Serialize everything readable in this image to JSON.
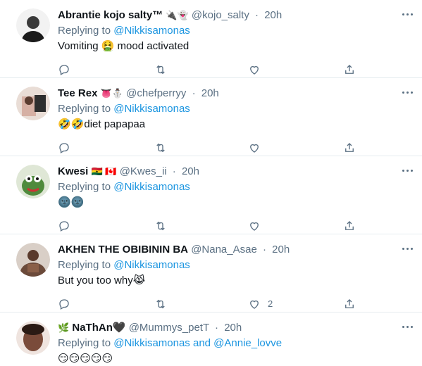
{
  "tweets": [
    {
      "name": "Abrantie kojo salty™",
      "emoji": "🔌👻",
      "handle": "@kojo_salty",
      "time": "20h",
      "replying_prefix": "Replying to",
      "mentions": "@Nikkisamonas",
      "text": "Vomiting 🤮 mood activated",
      "like_count": "",
      "avatar_color": "#2b2b2b"
    },
    {
      "name": "Tee Rex",
      "emoji": "👅⛄",
      "handle": "@chefperryy",
      "time": "20h",
      "replying_prefix": "Replying to",
      "mentions": "@Nikkisamonas",
      "text": "🤣🤣diet papapaa",
      "like_count": "",
      "avatar_color": "#c9a89c"
    },
    {
      "name": "Kwesi",
      "emoji": "🇬🇭 🇨🇦",
      "handle": "@Kwes_ii",
      "time": "20h",
      "replying_prefix": "Replying to",
      "mentions": "@Nikkisamonas",
      "text": "🌚🌚",
      "like_count": "",
      "avatar_color": "#4f8a3c"
    },
    {
      "name": "AKHEN THE OBIBININ BA",
      "emoji": "",
      "handle": "@Nana_Asae",
      "time": "20h",
      "replying_prefix": "Replying to",
      "mentions": "@Nikkisamonas",
      "text": "But you too why😹",
      "like_count": "2",
      "avatar_color": "#6b4a3a"
    },
    {
      "name": "NaThAn🖤",
      "emoji": "🌿",
      "handle": "@Mummys_petT",
      "time": "20h",
      "replying_prefix": "Replying to",
      "mentions": "@Nikkisamonas and @Annie_lovve",
      "text": "😏😏😏😏😏",
      "like_count": "",
      "avatar_color": "#7a4b3a"
    }
  ]
}
